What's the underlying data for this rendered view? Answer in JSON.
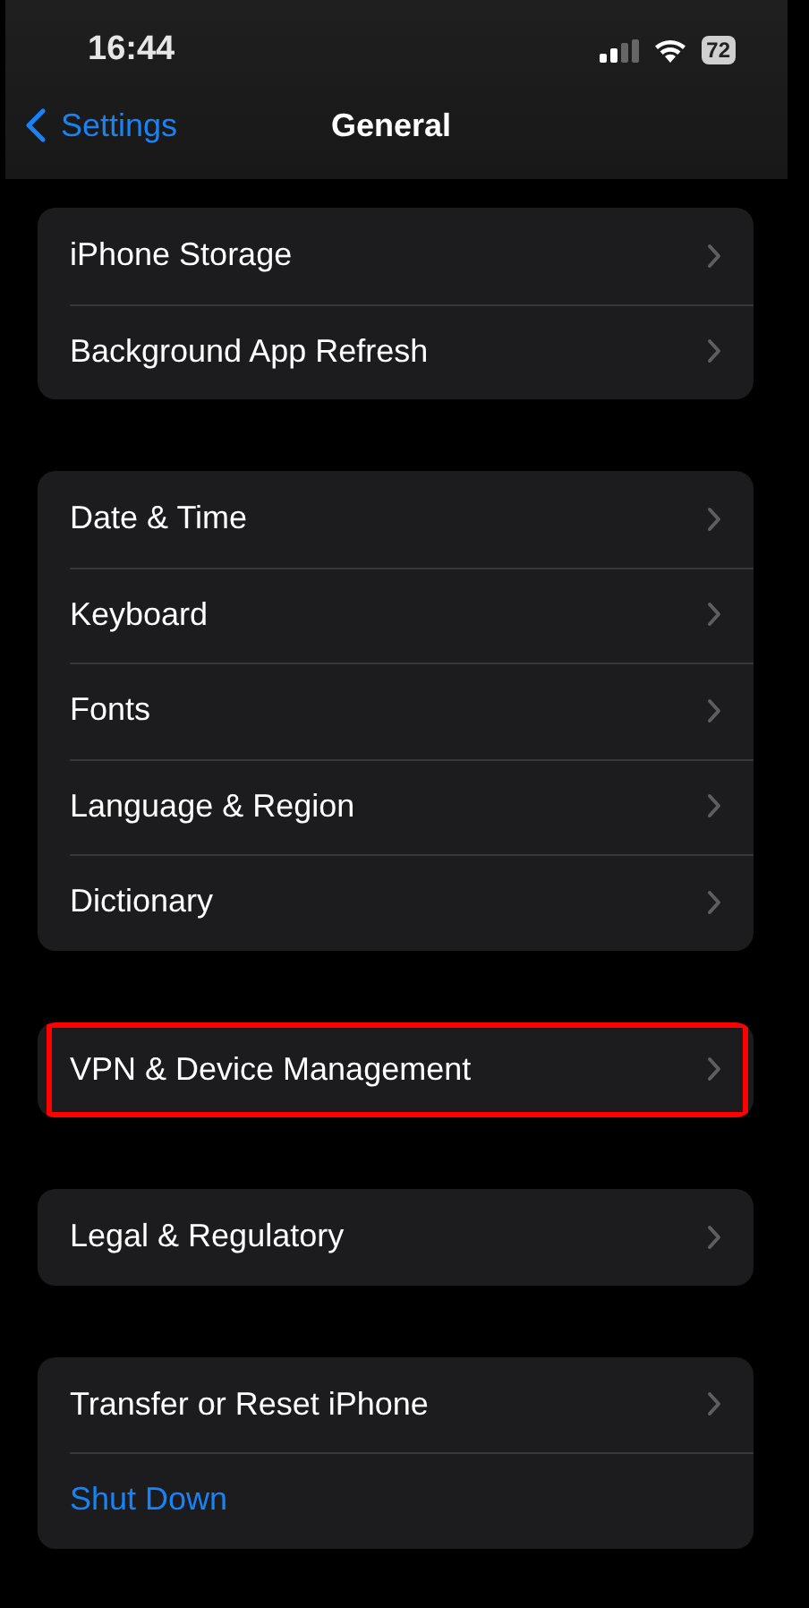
{
  "status_bar": {
    "time": "16:44",
    "battery": "72"
  },
  "nav": {
    "back": "Settings",
    "title": "General"
  },
  "groups": [
    {
      "rows": [
        {
          "kind": "link",
          "label": "iPhone Storage",
          "highlighted": false
        },
        {
          "kind": "link",
          "label": "Background App Refresh",
          "highlighted": false
        }
      ]
    },
    {
      "rows": [
        {
          "kind": "link",
          "label": "Date & Time",
          "highlighted": false
        },
        {
          "kind": "link",
          "label": "Keyboard",
          "highlighted": false
        },
        {
          "kind": "link",
          "label": "Fonts",
          "highlighted": false
        },
        {
          "kind": "link",
          "label": "Language & Region",
          "highlighted": false
        },
        {
          "kind": "link",
          "label": "Dictionary",
          "highlighted": false
        }
      ]
    },
    {
      "rows": [
        {
          "kind": "link",
          "label": "VPN & Device Management",
          "highlighted": true
        }
      ]
    },
    {
      "rows": [
        {
          "kind": "link",
          "label": "Legal & Regulatory",
          "highlighted": false
        }
      ]
    },
    {
      "rows": [
        {
          "kind": "link",
          "label": "Transfer or Reset iPhone",
          "highlighted": false
        },
        {
          "kind": "action",
          "label": "Shut Down",
          "highlighted": false
        }
      ]
    }
  ]
}
